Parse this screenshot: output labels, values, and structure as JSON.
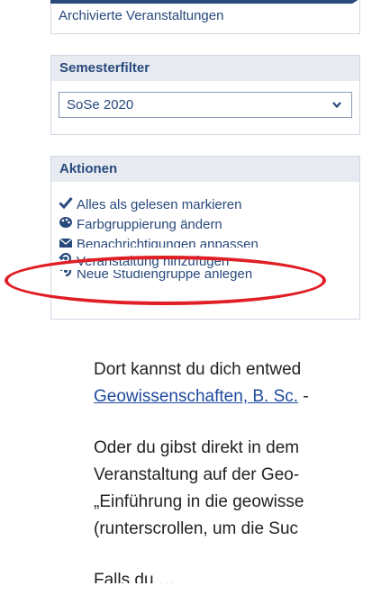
{
  "top_panel": {
    "archived_link": "Archivierte Veranstaltungen"
  },
  "semester_filter": {
    "title": "Semesterfilter",
    "selected": "SoSe 2020"
  },
  "actions": {
    "title": "Aktionen",
    "items": [
      {
        "icon": "checkmark-icon",
        "label": "Alles als gelesen markieren"
      },
      {
        "icon": "palette-icon",
        "label": "Farbgruppierung ändern"
      },
      {
        "icon": "mail-icon",
        "label": "Benachrichtigungen anpassen"
      },
      {
        "icon": "add-course-icon",
        "label": "Veranstaltung hinzufügen"
      },
      {
        "icon": "add-group-icon",
        "label": "Neue Studiengruppe anlegen"
      }
    ]
  },
  "highlight_color": "#e01e25",
  "instructions": {
    "line1": "Dort kannst du dich entwed",
    "line2_link": "Geowissenschaften, B. Sc.",
    "line2_rest": " -",
    "line3": "Oder du gibst direkt in dem",
    "line4": "Veranstaltung auf der Geo-",
    "line5": "„Einführung in die geowisse",
    "line6": "(runterscrollen, um die Suc",
    "line7": "Falls du …"
  }
}
